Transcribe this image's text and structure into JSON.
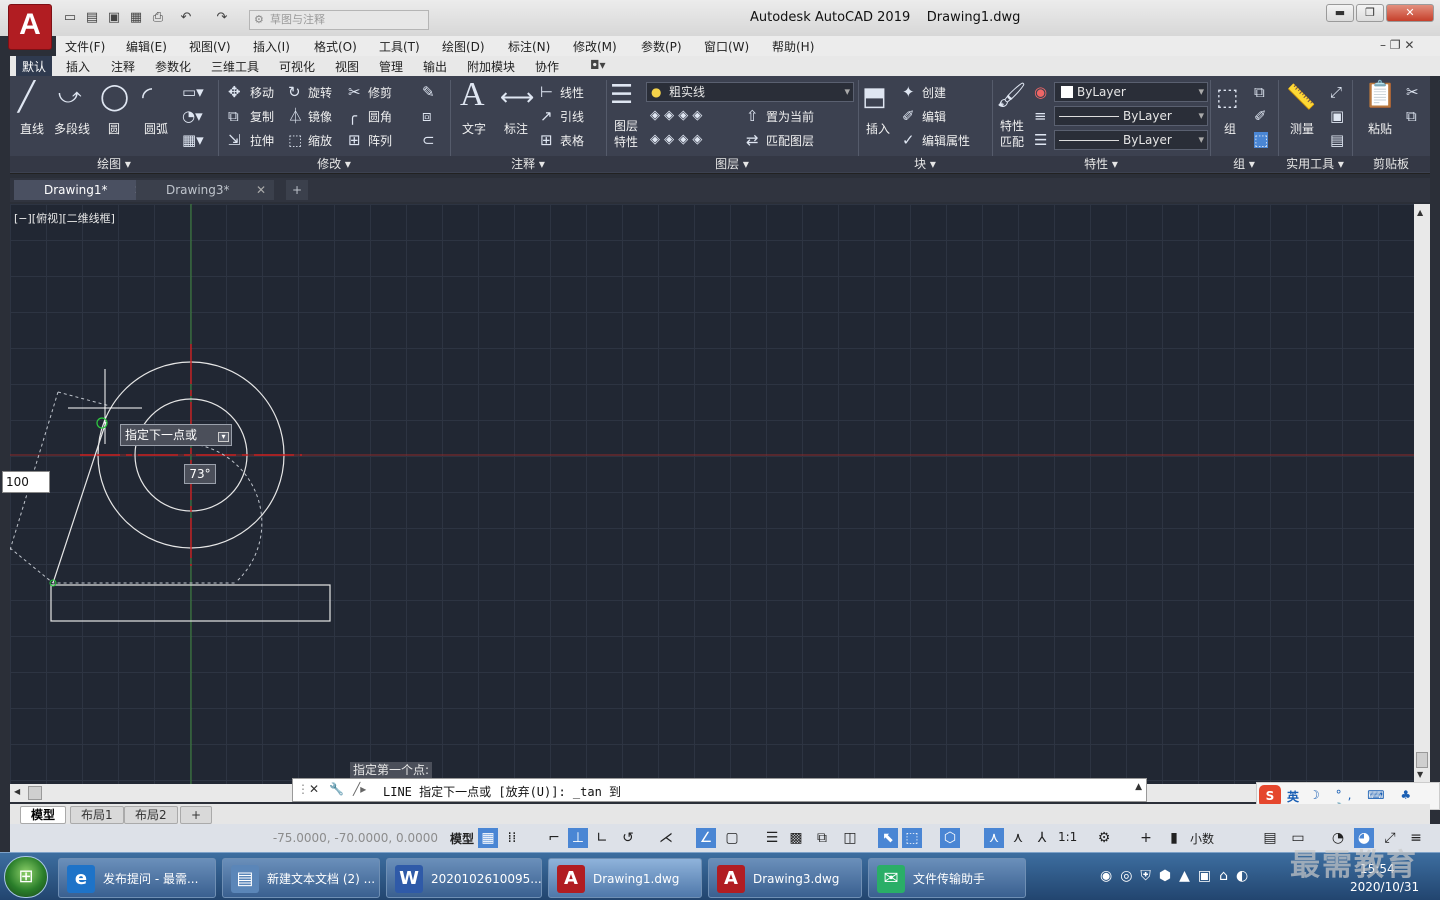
{
  "app": {
    "title": "Autodesk AutoCAD 2019",
    "file": "Drawing1.dwg",
    "logo": "A"
  },
  "quick_access": {
    "workspace": "草图与注释"
  },
  "menu": [
    "文件(F)",
    "编辑(E)",
    "视图(V)",
    "插入(I)",
    "格式(O)",
    "工具(T)",
    "绘图(D)",
    "标注(N)",
    "修改(M)",
    "参数(P)",
    "窗口(W)",
    "帮助(H)"
  ],
  "ribbon_tabs": [
    "默认",
    "插入",
    "注释",
    "参数化",
    "三维工具",
    "可视化",
    "视图",
    "管理",
    "输出",
    "附加模块",
    "协作"
  ],
  "ribbon": {
    "draw": {
      "title": "绘图",
      "line": "直线",
      "polyline": "多段线",
      "circle": "圆",
      "arc": "圆弧"
    },
    "modify": {
      "title": "修改",
      "move": "移动",
      "rotate": "旋转",
      "trim": "修剪",
      "copy": "复制",
      "mirror": "镜像",
      "fillet": "圆角",
      "stretch": "拉伸",
      "scale": "缩放",
      "array": "阵列"
    },
    "annotation": {
      "title": "注释",
      "text": "文字",
      "dimension": "标注",
      "linear": "线性",
      "leader": "引线",
      "table": "表格"
    },
    "layers": {
      "title": "图层",
      "properties": "图层\n特性",
      "current_layer": "粗实线",
      "set_current": "置为当前",
      "match_layer": "匹配图层"
    },
    "block": {
      "title": "块",
      "insert": "插入",
      "create": "创建",
      "edit": "编辑",
      "edit_attr": "编辑属性"
    },
    "properties": {
      "title": "特性",
      "match": "特性\n匹配",
      "color": "ByLayer",
      "linetype": "ByLayer",
      "lineweight": "ByLayer"
    },
    "groups": {
      "title": "组",
      "group": "组"
    },
    "utilities": {
      "title": "实用工具",
      "measure": "测量"
    },
    "clipboard": {
      "title": "剪贴板",
      "paste": "粘贴"
    }
  },
  "doc_tabs": [
    {
      "label": "Drawing1*",
      "active": true
    },
    {
      "label": "Drawing3*",
      "active": false
    }
  ],
  "viewport_controls": "[−][俯视][二维线框]",
  "dynamic_input": {
    "prompt": "指定下一点或",
    "angle": "73°",
    "length": "100"
  },
  "command": {
    "hint": "指定第一个点:",
    "text": "LINE 指定下一点或 [放弃(U)]: _tan 到"
  },
  "layout_tabs": [
    "模型",
    "布局1",
    "布局2"
  ],
  "status": {
    "coords": "-75.0000, -70.0000, 0.0000",
    "model": "模型",
    "scale": "1:1",
    "units": "小数"
  },
  "taskbar": {
    "items": [
      {
        "label": "发布提问 - 最需...",
        "icon": "ie-icon",
        "color": "#1e73c8"
      },
      {
        "label": "新建文本文档 (2) ...",
        "icon": "notepad-icon",
        "color": "#5b86b8"
      },
      {
        "label": "2020102610095...",
        "icon": "word-icon",
        "color": "#2f5aa8"
      },
      {
        "label": "Drawing1.dwg",
        "icon": "autocad-icon",
        "color": "#b11d22"
      },
      {
        "label": "Drawing3.dwg",
        "icon": "autocad-icon",
        "color": "#b11d22"
      },
      {
        "label": "文件传输助手",
        "icon": "wechat-icon",
        "color": "#2aae67"
      }
    ],
    "time": "15:54",
    "date": "2020/10/31"
  },
  "ime": {
    "lang": "英"
  },
  "watermark": "最需教育"
}
